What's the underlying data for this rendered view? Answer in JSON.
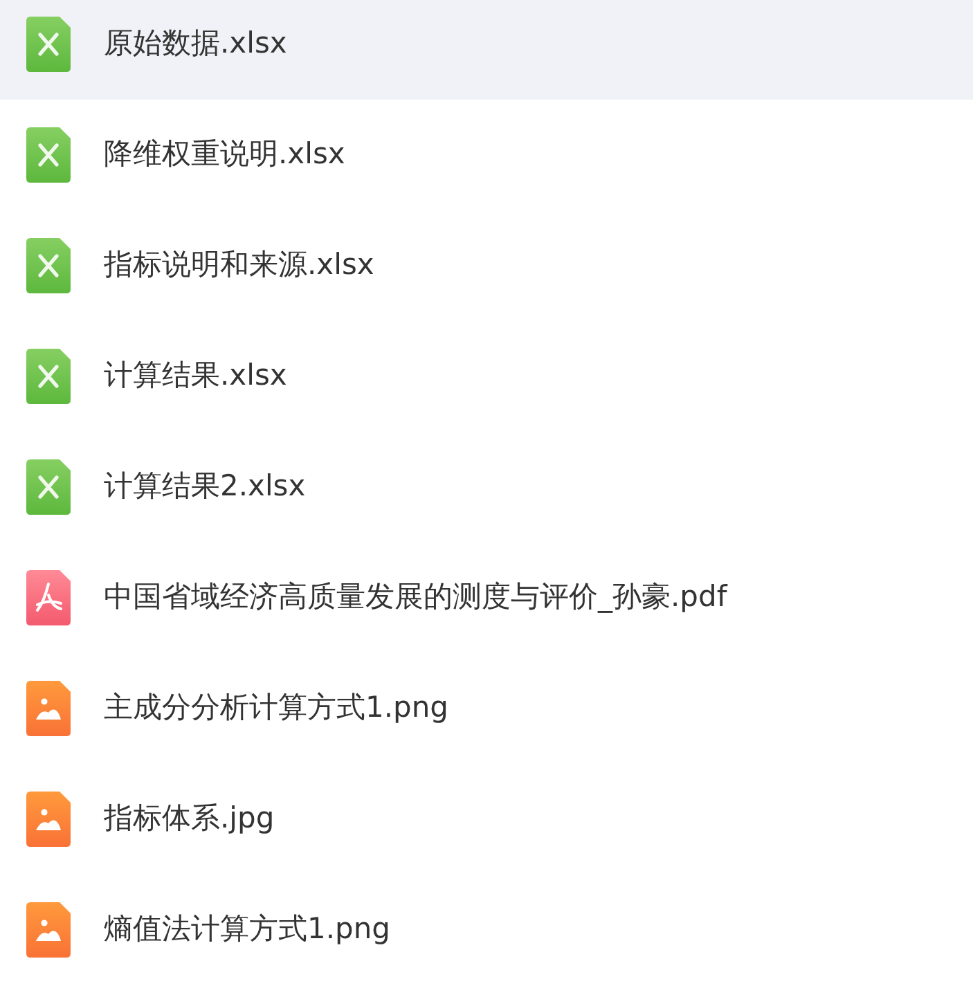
{
  "files": [
    {
      "name": "原始数据.xlsx",
      "kind": "sheet",
      "selected": true
    },
    {
      "name": "降维权重说明.xlsx",
      "kind": "sheet",
      "selected": false
    },
    {
      "name": "指标说明和来源.xlsx",
      "kind": "sheet",
      "selected": false
    },
    {
      "name": "计算结果.xlsx",
      "kind": "sheet",
      "selected": false
    },
    {
      "name": "计算结果2.xlsx",
      "kind": "sheet",
      "selected": false
    },
    {
      "name": "中国省域经济高质量发展的测度与评价_孙豪.pdf",
      "kind": "pdf",
      "selected": false
    },
    {
      "name": "主成分分析计算方式1.png",
      "kind": "image",
      "selected": false
    },
    {
      "name": "指标体系.jpg",
      "kind": "image",
      "selected": false
    },
    {
      "name": "熵值法计算方式1.png",
      "kind": "image",
      "selected": false
    }
  ]
}
